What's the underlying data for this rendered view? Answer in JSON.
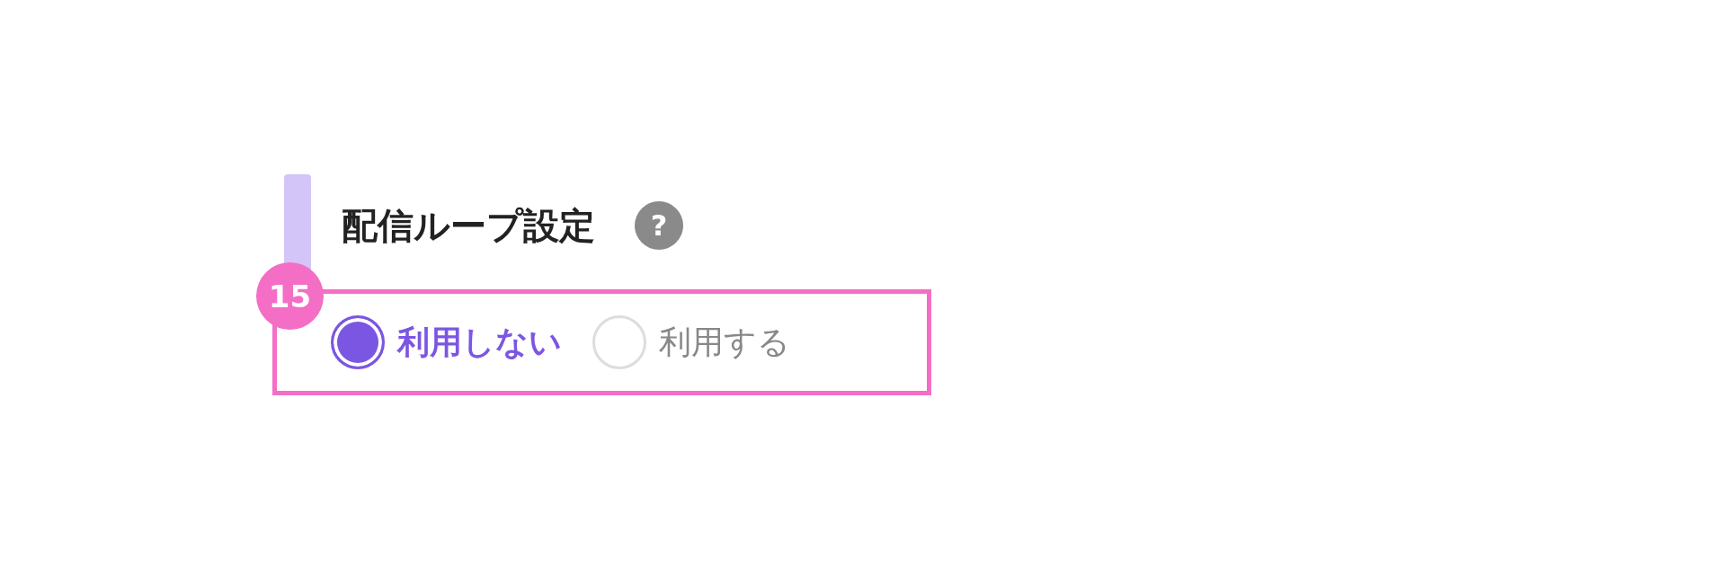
{
  "section": {
    "title": "配信ループ設定",
    "help": "?"
  },
  "annotation": {
    "number": "15"
  },
  "options": [
    {
      "label": "利用しない",
      "selected": true
    },
    {
      "label": "利用する",
      "selected": false
    }
  ]
}
